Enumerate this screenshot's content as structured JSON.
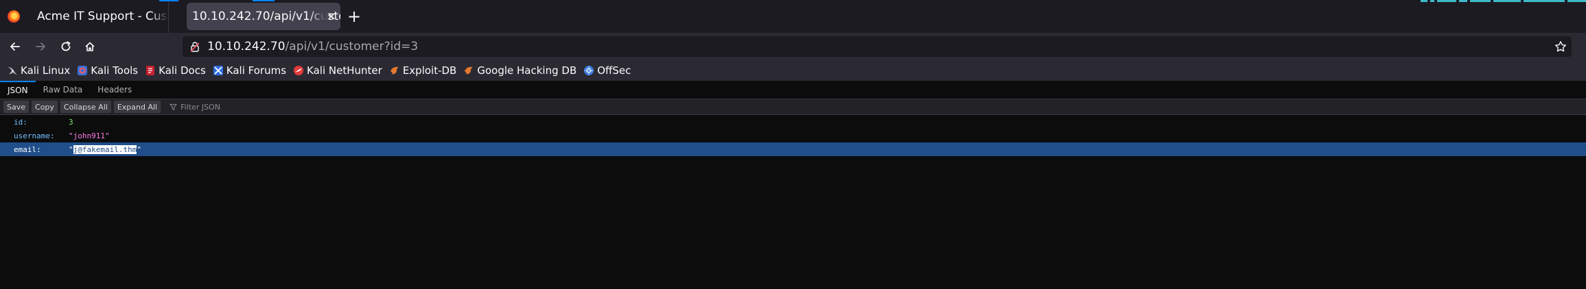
{
  "tabs": [
    {
      "title": "Acme IT Support - Customer",
      "active": false
    },
    {
      "title": "10.10.242.70/api/v1/customer",
      "active": true
    }
  ],
  "url": {
    "host": "10.10.242.70",
    "path": "/api/v1/customer?id=3"
  },
  "bookmarks": [
    {
      "label": "Kali Linux",
      "icon": "kali-dragon-icon"
    },
    {
      "label": "Kali Tools",
      "icon": "kali-tools-icon"
    },
    {
      "label": "Kali Docs",
      "icon": "kali-docs-icon"
    },
    {
      "label": "Kali Forums",
      "icon": "kali-forums-icon"
    },
    {
      "label": "Kali NetHunter",
      "icon": "kali-nethunter-icon"
    },
    {
      "label": "Exploit-DB",
      "icon": "exploit-db-icon"
    },
    {
      "label": "Google Hacking DB",
      "icon": "ghdb-icon"
    },
    {
      "label": "OffSec",
      "icon": "offsec-icon"
    }
  ],
  "viewer": {
    "tabs": [
      "JSON",
      "Raw Data",
      "Headers"
    ],
    "toolbar": {
      "save": "Save",
      "copy": "Copy",
      "collapse_all": "Collapse All",
      "expand_all": "Expand All",
      "filter_placeholder": "Filter JSON"
    },
    "rows": [
      {
        "key": "id:",
        "value": "3",
        "type": "number"
      },
      {
        "key": "username:",
        "value": "\"john911\"",
        "type": "string"
      },
      {
        "key": "email:",
        "value": "j@fakemail.thm",
        "type": "string",
        "selected": true
      }
    ]
  },
  "colors": {
    "accent": "#0a84ff",
    "selection": "#204e8a",
    "json_key": "#75bfff",
    "json_string": "#ff7de9",
    "json_number": "#86de74"
  }
}
